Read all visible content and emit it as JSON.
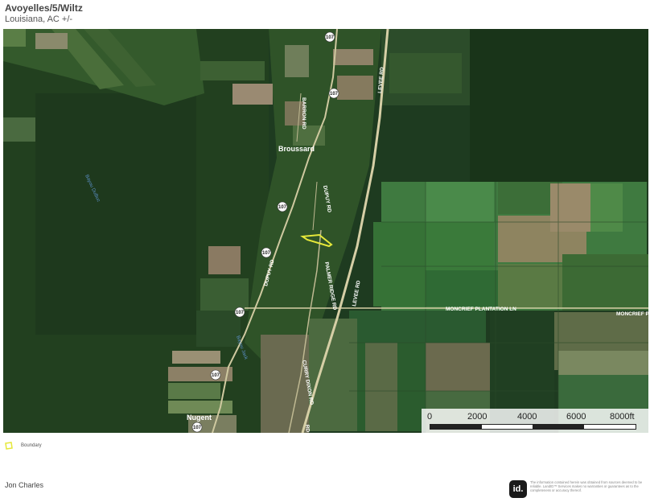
{
  "header": {
    "title": "Avoyelles/5/Wiltz",
    "subtitle": "Louisiana,  AC +/-"
  },
  "map": {
    "roads": {
      "barron": "BARRON RD",
      "levee_north": "LEVEE RD",
      "dupuy_north": "DUPUY RD",
      "dupuy_south": "DUPUY RD",
      "palmer_ridge": "PALMER RIDGE RD",
      "levee_south": "LEVEE RD",
      "moncrief": "MONCRIEF PLANTATION LN",
      "moncrief_east": "MONCRIEF PL",
      "curry_dixon": "CURRY DIXON RD",
      "rd_south": "RD"
    },
    "route_shields": [
      "107",
      "107",
      "107",
      "107",
      "107",
      "107",
      "107"
    ],
    "places": {
      "broussard": "Broussard",
      "nugent": "Nugent"
    },
    "water": {
      "bayou_dubuc": "Bayou DuBuc",
      "bayou_jack": "Bayou Jack"
    },
    "boundary_color": "#e5e83a"
  },
  "scale": {
    "labels": [
      "0",
      "2000",
      "4000",
      "6000",
      "8000ft"
    ]
  },
  "legend": {
    "boundary_label": "Boundary"
  },
  "footer": {
    "agent": "Jon Charles",
    "logo_text": "id.",
    "disclaimer": "The information contained herein was obtained from sources deemed to be reliable. LandID™ Services makes no warranties or guarantees as to the completeness or accuracy thereof."
  }
}
